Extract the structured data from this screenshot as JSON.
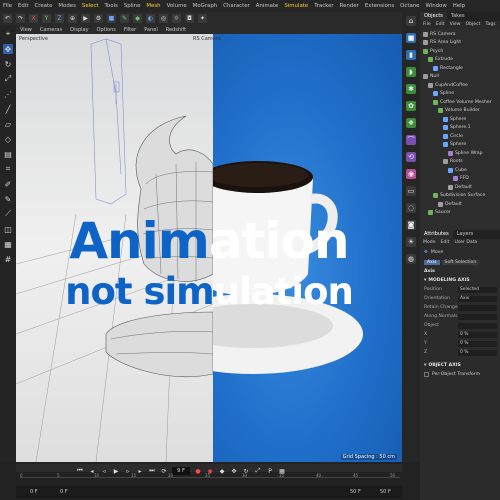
{
  "menu": [
    "File",
    "Edit",
    "Create",
    "Modes",
    "Select",
    "Tools",
    "Spline",
    "Mesh",
    "Volume",
    "MoGraph",
    "Character",
    "Animate",
    "Simulate",
    "Tracker",
    "Render",
    "Extensions",
    "Octane",
    "Window",
    "Help"
  ],
  "viewport": {
    "menu": [
      "View",
      "Cameras",
      "Display",
      "Options",
      "Filter",
      "Panel",
      "Redshift"
    ],
    "left_label": "Perspective",
    "right_label": "RS Camera",
    "grid_spacing": "Grid Spacing : 50 cm"
  },
  "headline": {
    "line1_a": "Anim",
    "line1_b": "ation",
    "line2_a": "not sim",
    "line2_b": "ulation"
  },
  "objects_panel": {
    "tabs": [
      "Objects",
      "Takes"
    ],
    "menu": [
      "File",
      "Edit",
      "View",
      "Object",
      "Tags"
    ],
    "tree": [
      {
        "label": "RS Camera",
        "indent": 0,
        "color": "#9e9e9e"
      },
      {
        "label": "RS Area Light",
        "indent": 0,
        "color": "#9e9e9e"
      },
      {
        "label": "Psych",
        "indent": 0,
        "color": "#6fb35a"
      },
      {
        "label": "Extrude",
        "indent": 1,
        "color": "#6fb35a"
      },
      {
        "label": "Rectangle",
        "indent": 2,
        "color": "#6aa6ff"
      },
      {
        "label": "Null",
        "indent": 0,
        "color": "#9e9e9e"
      },
      {
        "label": "CupAndCoffee",
        "indent": 1,
        "color": "#9e9e9e"
      },
      {
        "label": "Spline",
        "indent": 2,
        "color": "#6aa6ff"
      },
      {
        "label": "Coffee Volume Mesher",
        "indent": 2,
        "color": "#6fb35a"
      },
      {
        "label": "Volume Builder",
        "indent": 3,
        "color": "#6fb35a"
      },
      {
        "label": "Sphere",
        "indent": 4,
        "color": "#6aa6ff"
      },
      {
        "label": "Sphere.1",
        "indent": 4,
        "color": "#6aa6ff"
      },
      {
        "label": "Circle",
        "indent": 4,
        "color": "#6aa6ff"
      },
      {
        "label": "Sphere",
        "indent": 4,
        "color": "#6aa6ff"
      },
      {
        "label": "Spline Wrap",
        "indent": 5,
        "color": "#a67cd6"
      },
      {
        "label": "Roots",
        "indent": 4,
        "color": "#9e9e9e"
      },
      {
        "label": "Cube",
        "indent": 5,
        "color": "#6aa6ff"
      },
      {
        "label": "FFD",
        "indent": 6,
        "color": "#a67cd6"
      },
      {
        "label": "Default",
        "indent": 5,
        "color": "#9e9e9e"
      },
      {
        "label": "Subdivision Surface",
        "indent": 2,
        "color": "#6fb35a"
      },
      {
        "label": "Default",
        "indent": 3,
        "color": "#9e9e9e"
      },
      {
        "label": "Saucer",
        "indent": 1,
        "color": "#6fb35a"
      }
    ]
  },
  "attributes": {
    "tabs": [
      "Attributes",
      "Layers"
    ],
    "menu": [
      "Mode",
      "Edit",
      "User Data"
    ],
    "tool": "Move",
    "subtabs": [
      "Axis",
      "Soft Selection"
    ],
    "section_axis": "Axis",
    "modeling_axis": "MODELING AXIS",
    "rows": [
      {
        "label": "Position",
        "value": "Selected"
      },
      {
        "label": "Orientation",
        "value": "Axis"
      },
      {
        "label": "Retain Changes",
        "value": ""
      },
      {
        "label": "Along Normals",
        "value": ""
      },
      {
        "label": "Object",
        "value": ""
      },
      {
        "label": "X",
        "value": "0 %"
      },
      {
        "label": "Y",
        "value": "0 %"
      },
      {
        "label": "Z",
        "value": "0 %"
      }
    ],
    "object_axis": "OBJECT AXIS",
    "per_object": "Per-Object Transform"
  },
  "timeline": {
    "current_frame": "9 F",
    "start": "0 F",
    "start2": "0 F",
    "end": "50 F",
    "end2": "50 F",
    "ticks": [
      "0",
      "5",
      "10",
      "15",
      "20",
      "25",
      "30",
      "35",
      "40",
      "45",
      "50"
    ]
  }
}
